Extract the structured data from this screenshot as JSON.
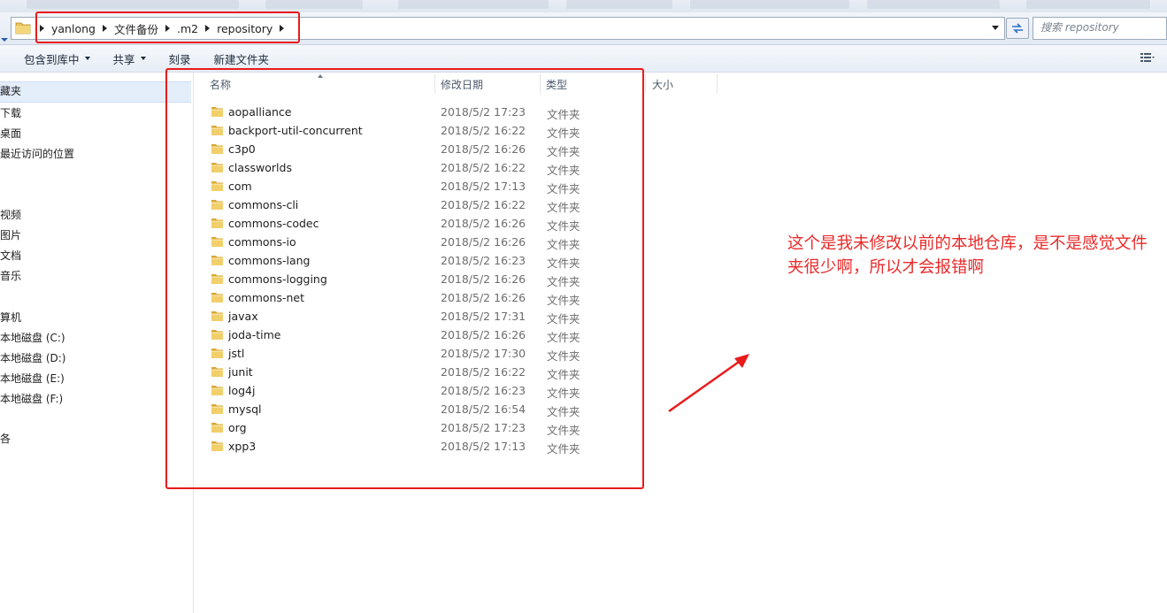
{
  "address_bar": {
    "breadcrumbs": [
      "yanlong",
      "文件备份",
      ".m2",
      "repository"
    ]
  },
  "search": {
    "placeholder": "搜索 repository"
  },
  "toolbar": {
    "buttons": [
      {
        "label": "包含到库中",
        "dropdown": true
      },
      {
        "label": "共享",
        "dropdown": true
      },
      {
        "label": "刻录",
        "dropdown": false
      },
      {
        "label": "新建文件夹",
        "dropdown": false
      }
    ]
  },
  "sidebar": {
    "items": [
      "藏夹",
      "下载",
      "桌面",
      "最近访问的位置",
      "视频",
      "图片",
      "文档",
      "音乐",
      "算机",
      "本地磁盘 (C:)",
      "本地磁盘 (D:)",
      "本地磁盘 (E:)",
      "本地磁盘 (F:)",
      "各"
    ]
  },
  "columns": {
    "name": "名称",
    "modified": "修改日期",
    "type": "类型",
    "size": "大小"
  },
  "files": [
    {
      "name": "aopalliance",
      "modified": "2018/5/2 17:23",
      "type": "文件夹"
    },
    {
      "name": "backport-util-concurrent",
      "modified": "2018/5/2 16:22",
      "type": "文件夹"
    },
    {
      "name": "c3p0",
      "modified": "2018/5/2 16:26",
      "type": "文件夹"
    },
    {
      "name": "classworlds",
      "modified": "2018/5/2 16:22",
      "type": "文件夹"
    },
    {
      "name": "com",
      "modified": "2018/5/2 17:13",
      "type": "文件夹"
    },
    {
      "name": "commons-cli",
      "modified": "2018/5/2 16:22",
      "type": "文件夹"
    },
    {
      "name": "commons-codec",
      "modified": "2018/5/2 16:26",
      "type": "文件夹"
    },
    {
      "name": "commons-io",
      "modified": "2018/5/2 16:26",
      "type": "文件夹"
    },
    {
      "name": "commons-lang",
      "modified": "2018/5/2 16:23",
      "type": "文件夹"
    },
    {
      "name": "commons-logging",
      "modified": "2018/5/2 16:26",
      "type": "文件夹"
    },
    {
      "name": "commons-net",
      "modified": "2018/5/2 16:26",
      "type": "文件夹"
    },
    {
      "name": "javax",
      "modified": "2018/5/2 17:31",
      "type": "文件夹"
    },
    {
      "name": "joda-time",
      "modified": "2018/5/2 16:26",
      "type": "文件夹"
    },
    {
      "name": "jstl",
      "modified": "2018/5/2 17:30",
      "type": "文件夹"
    },
    {
      "name": "junit",
      "modified": "2018/5/2 16:22",
      "type": "文件夹"
    },
    {
      "name": "log4j",
      "modified": "2018/5/2 16:23",
      "type": "文件夹"
    },
    {
      "name": "mysql",
      "modified": "2018/5/2 16:54",
      "type": "文件夹"
    },
    {
      "name": "org",
      "modified": "2018/5/2 17:23",
      "type": "文件夹"
    },
    {
      "name": "xpp3",
      "modified": "2018/5/2 17:13",
      "type": "文件夹"
    }
  ],
  "annotation": {
    "text": "这个是我未修改以前的本地仓库，是不是感觉文件夹很少啊，所以才会报错啊",
    "color": "#ea2a2a"
  },
  "colors": {
    "highlight_red": "#ea1b1b",
    "folder_yellow": "#e8c15a"
  }
}
